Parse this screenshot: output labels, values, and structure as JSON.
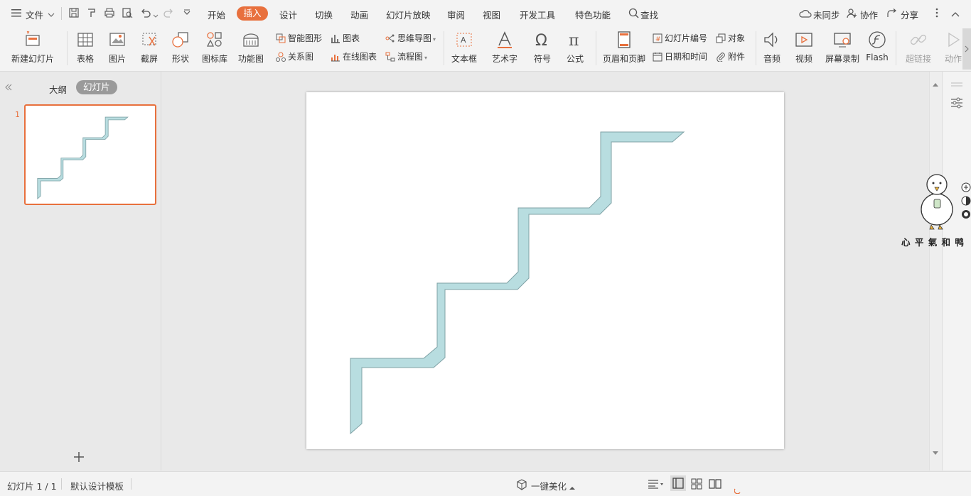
{
  "menubar": {
    "file_label": "文件",
    "tabs": [
      "开始",
      "插入",
      "设计",
      "切换",
      "动画",
      "幻灯片放映",
      "审阅",
      "视图",
      "开发工具",
      "特色功能"
    ],
    "active_tab": "插入",
    "search_label": "查找",
    "sync_label": "未同步",
    "collab_label": "协作",
    "share_label": "分享"
  },
  "ribbon": {
    "new_slide": "新建幻灯片",
    "table": "表格",
    "picture": "图片",
    "screenshot": "截屏",
    "shape": "形状",
    "icon_lib": "图标库",
    "func_chart": "功能图",
    "smart_shape": "智能图形",
    "chart": "图表",
    "relation": "关系图",
    "online_chart": "在线图表",
    "mindmap": "思维导图",
    "flowchart": "流程图",
    "textbox": "文本框",
    "wordart": "艺术字",
    "symbol": "符号",
    "formula": "公式",
    "header_footer": "页眉和页脚",
    "slide_number": "幻灯片编号",
    "object": "对象",
    "datetime": "日期和时间",
    "attachment": "附件",
    "audio": "音频",
    "video": "视频",
    "screen_record": "屏幕录制",
    "flash": "Flash",
    "hyperlink": "超链接",
    "action": "动作"
  },
  "left_panel": {
    "outline_tab": "大纲",
    "slides_tab": "幻灯片",
    "slide_number": "1",
    "add_icon": "plus-icon"
  },
  "sticker": {
    "text": "心 平 氣 和 鸭"
  },
  "statusbar": {
    "slide_info": "幻灯片 1 / 1",
    "template": "默认设计模板",
    "beautify": "一键美化"
  },
  "colors": {
    "accent": "#e8703d",
    "shape_fill": "#b8dde0",
    "shape_stroke": "#7fa2a6"
  }
}
